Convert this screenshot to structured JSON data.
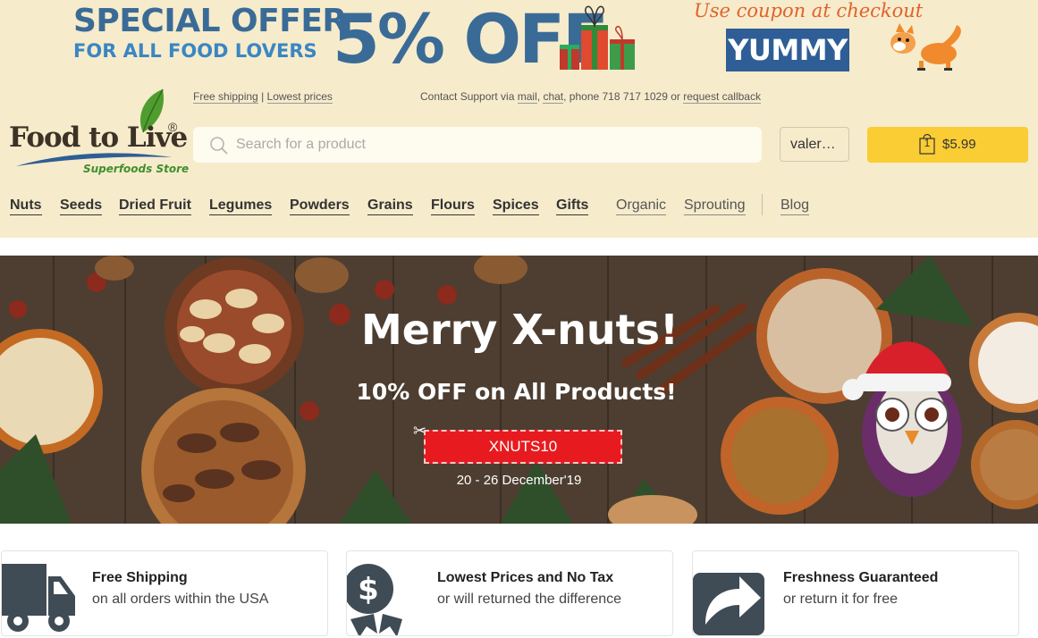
{
  "promo": {
    "special_offer": "SPECIAL OFFER",
    "for_lovers": "FOR ALL FOOD LOVERS",
    "discount": "5% OFF",
    "coupon_hint": "Use coupon at checkout",
    "coupon_code": "YUMMY"
  },
  "logo": {
    "name": "Food to Live",
    "registered": "®",
    "tagline": "Superfoods Store"
  },
  "info": {
    "free_shipping": "Free shipping",
    "separator": "|",
    "lowest_prices": "Lowest prices",
    "support_prefix": "Contact Support via",
    "mail": "mail",
    "chat": "chat",
    "phone": "phone 718 717 1029",
    "or": "or",
    "request_callback": "request callback"
  },
  "search": {
    "placeholder": "Search for a product"
  },
  "account": {
    "label": "valer…"
  },
  "cart": {
    "count": "1",
    "total": "$5.99"
  },
  "nav": {
    "items": [
      {
        "label": "Nuts"
      },
      {
        "label": "Seeds"
      },
      {
        "label": "Dried Fruit"
      },
      {
        "label": "Legumes"
      },
      {
        "label": "Powders"
      },
      {
        "label": "Grains"
      },
      {
        "label": "Flours"
      },
      {
        "label": "Spices"
      },
      {
        "label": "Gifts"
      },
      {
        "label": "Organic"
      },
      {
        "label": "Sprouting"
      },
      {
        "label": "Blog"
      }
    ]
  },
  "hero": {
    "title": "Merry X-nuts!",
    "subtitle": "10% OFF  on All Products!",
    "code": "XNUTS10",
    "dates": "20 - 26 December'19"
  },
  "features": [
    {
      "title": "Free Shipping",
      "text": "on all orders within the USA",
      "icon": "truck-icon"
    },
    {
      "title": "Lowest Prices and No Tax",
      "text": "or will returned the difference",
      "icon": "dollar-badge-icon"
    },
    {
      "title": "Freshness Guaranteed",
      "text": "or return it for free",
      "icon": "return-arrow-icon"
    }
  ],
  "colors": {
    "header_bg": "#f6ebcb",
    "promo_blue": "#3a6b97",
    "coupon_orange": "#e0622c",
    "cart_yellow": "#fbcd34",
    "code_red": "#e71b1f",
    "icon_gray": "#3f4b55"
  }
}
